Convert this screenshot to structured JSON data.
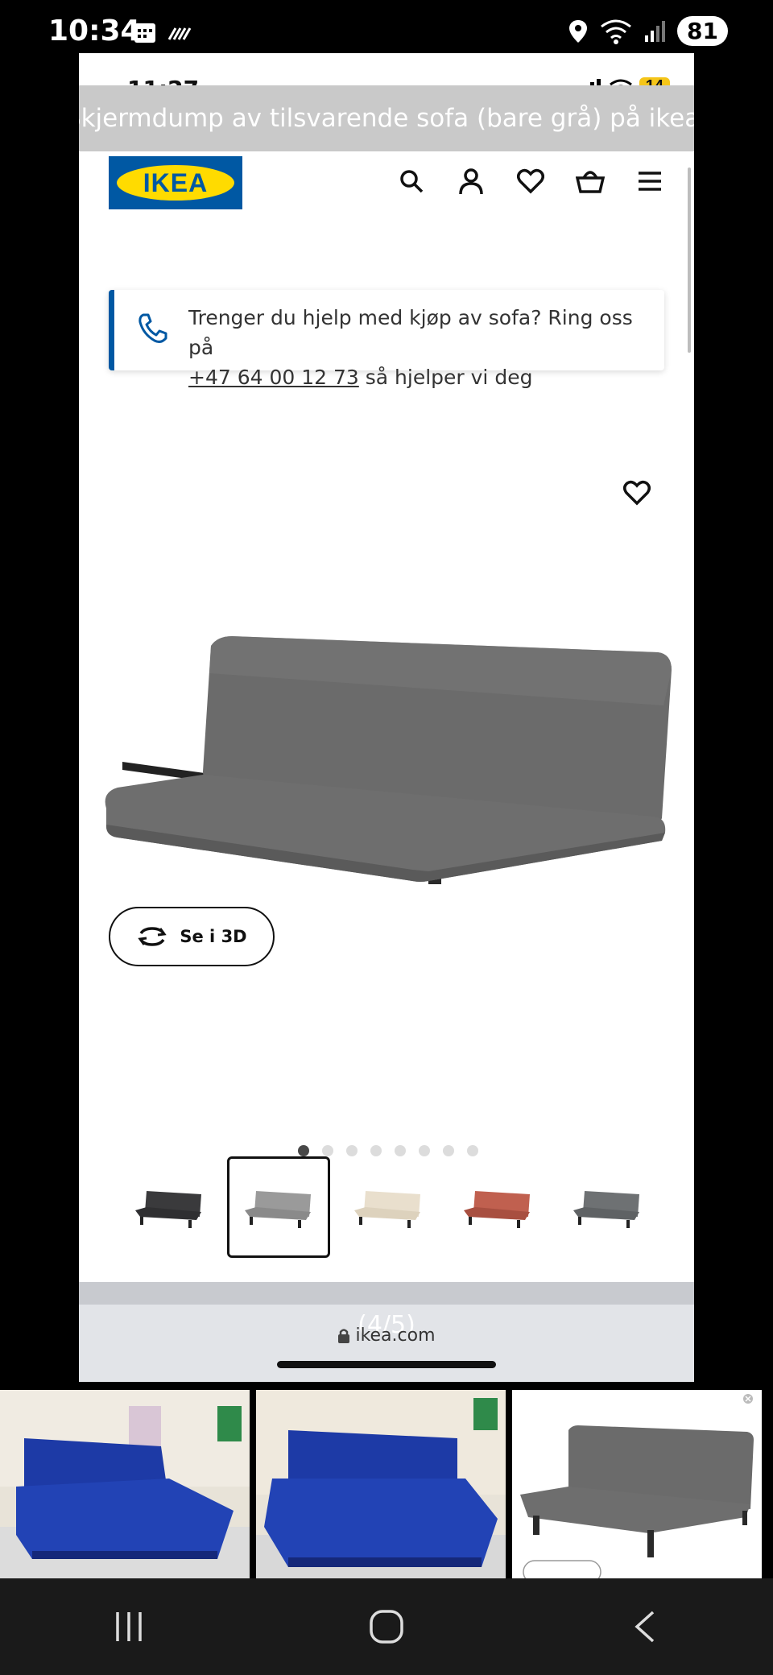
{
  "outer_status": {
    "time": "10:34",
    "battery": "81"
  },
  "inner_status": {
    "time": "11:27",
    "battery": "14"
  },
  "caption": "Skjermdump av tilsvarende sofa (bare grå) på ikea.",
  "ikea": {
    "logo_text": "IKEA",
    "header_icons": [
      "search-icon",
      "account-icon",
      "heart-icon",
      "basket-icon",
      "menu-icon"
    ]
  },
  "help_banner": {
    "text_before": "Trenger du hjelp med kjøp av sofa? Ring oss på",
    "phone": "+47 64 00 12 73",
    "text_after": "så hjelper vi deg"
  },
  "product": {
    "view3d_label": "Se i 3D",
    "dots_total": 8,
    "dots_active_index": 0,
    "variants": [
      {
        "color": "#3a3a3c",
        "selected": false
      },
      {
        "color": "#8f8f8f",
        "selected": true
      },
      {
        "color": "#e6dccb",
        "selected": false
      },
      {
        "color": "#b95a4a",
        "selected": false
      },
      {
        "color": "#6d7072",
        "selected": false
      }
    ]
  },
  "browser": {
    "counter": "(4/5)",
    "url": "ikea.com"
  },
  "colors": {
    "ikea_blue": "#0058a3",
    "ikea_yellow": "#ffdb00",
    "sofa_gray": "#6b6b6b",
    "sofa_blue": "#1d3aa6"
  },
  "navbar": [
    "recent-apps-icon",
    "home-icon",
    "back-icon"
  ]
}
